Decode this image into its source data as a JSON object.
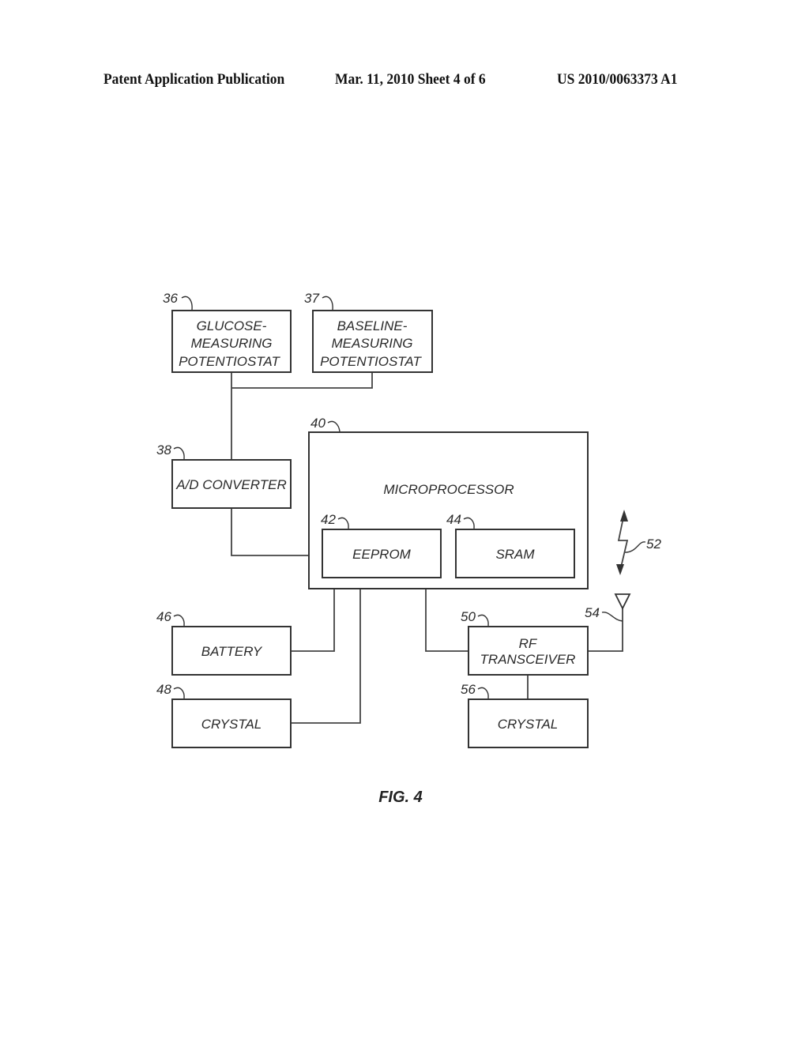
{
  "header": {
    "publication": "Patent Application Publication",
    "date_sheet": "Mar. 11, 2010  Sheet 4 of 6",
    "number": "US 2010/0063373 A1"
  },
  "figure": {
    "caption": "FIG. 4",
    "blocks": {
      "glucose_potentiostat": {
        "ref": "36",
        "lines": [
          "GLUCOSE-",
          "MEASURING",
          "POTENTIOSTAT"
        ]
      },
      "baseline_potentiostat": {
        "ref": "37",
        "lines": [
          "BASELINE-",
          "MEASURING",
          "POTENTIOSTAT"
        ]
      },
      "ad_converter": {
        "ref": "38",
        "lines": [
          "A/D CONVERTER"
        ]
      },
      "microprocessor": {
        "ref": "40",
        "lines": [
          "MICROPROCESSOR"
        ]
      },
      "eeprom": {
        "ref": "42",
        "lines": [
          "EEPROM"
        ]
      },
      "sram": {
        "ref": "44",
        "lines": [
          "SRAM"
        ]
      },
      "battery": {
        "ref": "46",
        "lines": [
          "BATTERY"
        ]
      },
      "crystal_main": {
        "ref": "48",
        "lines": [
          "CRYSTAL"
        ]
      },
      "rf_transceiver": {
        "ref": "50",
        "lines": [
          "RF",
          "TRANSCEIVER"
        ]
      },
      "crystal_rf": {
        "ref": "56",
        "lines": [
          "CRYSTAL"
        ]
      }
    },
    "signal": {
      "ref": "52"
    },
    "antenna": {
      "ref": "54"
    }
  }
}
